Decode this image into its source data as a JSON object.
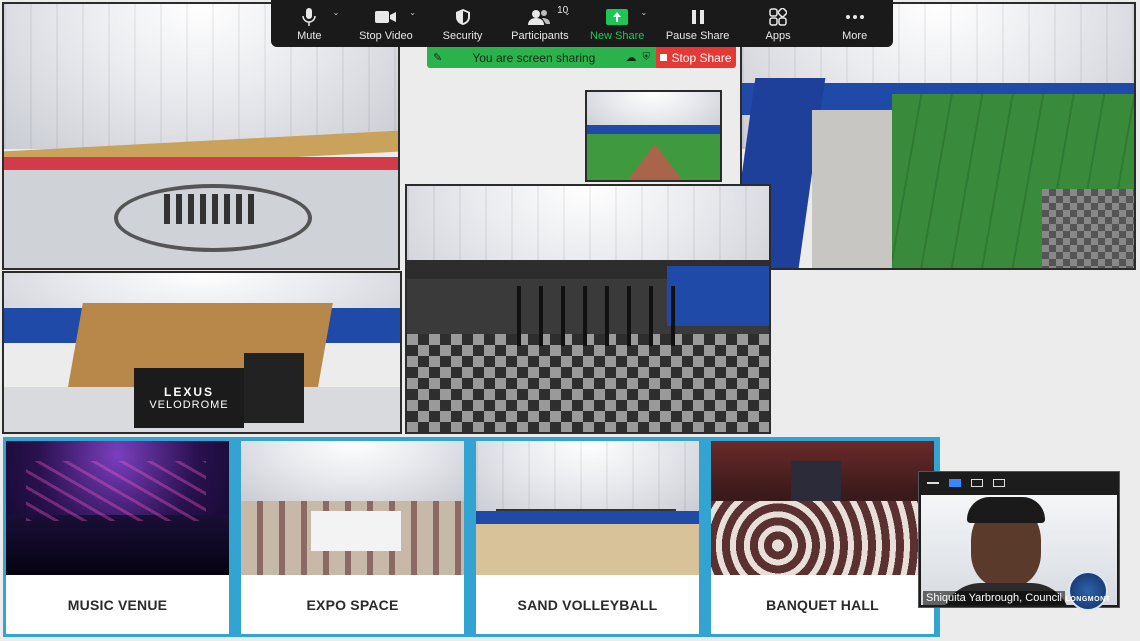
{
  "toolbar": {
    "items": [
      {
        "label": "Mute",
        "icon": "microphone-icon",
        "has_caret": true
      },
      {
        "label": "Stop Video",
        "icon": "video-camera-icon",
        "has_caret": true
      },
      {
        "label": "Security",
        "icon": "shield-icon",
        "has_caret": false
      },
      {
        "label": "Participants",
        "icon": "participants-icon",
        "count": "10",
        "has_caret": true
      },
      {
        "label": "New Share",
        "icon": "share-screen-icon",
        "has_caret": true,
        "accent": "#1ec65a"
      },
      {
        "label": "Pause Share",
        "icon": "pause-icon",
        "has_caret": false
      },
      {
        "label": "Apps",
        "icon": "apps-icon",
        "has_caret": false
      },
      {
        "label": "More",
        "icon": "more-dots-icon",
        "has_caret": false
      }
    ]
  },
  "share_bar": {
    "status_text": "You are screen sharing",
    "stop_label": "Stop Share",
    "status_color": "#2bb24c",
    "stop_color": "#e53935"
  },
  "venues": [
    {
      "label": "MUSIC VENUE"
    },
    {
      "label": "EXPO SPACE"
    },
    {
      "label": "SAND VOLLEYBALL"
    },
    {
      "label": "BANQUET HALL"
    }
  ],
  "velodrome_sign": {
    "line1": "LEXUS",
    "line2": "VELODROME"
  },
  "participant": {
    "name": "Shiquita Yarbrough, Council",
    "watermark": "LONGMONT"
  },
  "colors": {
    "venue_frame": "#33a3d1",
    "toolbar_bg": "#1a1a1a"
  }
}
